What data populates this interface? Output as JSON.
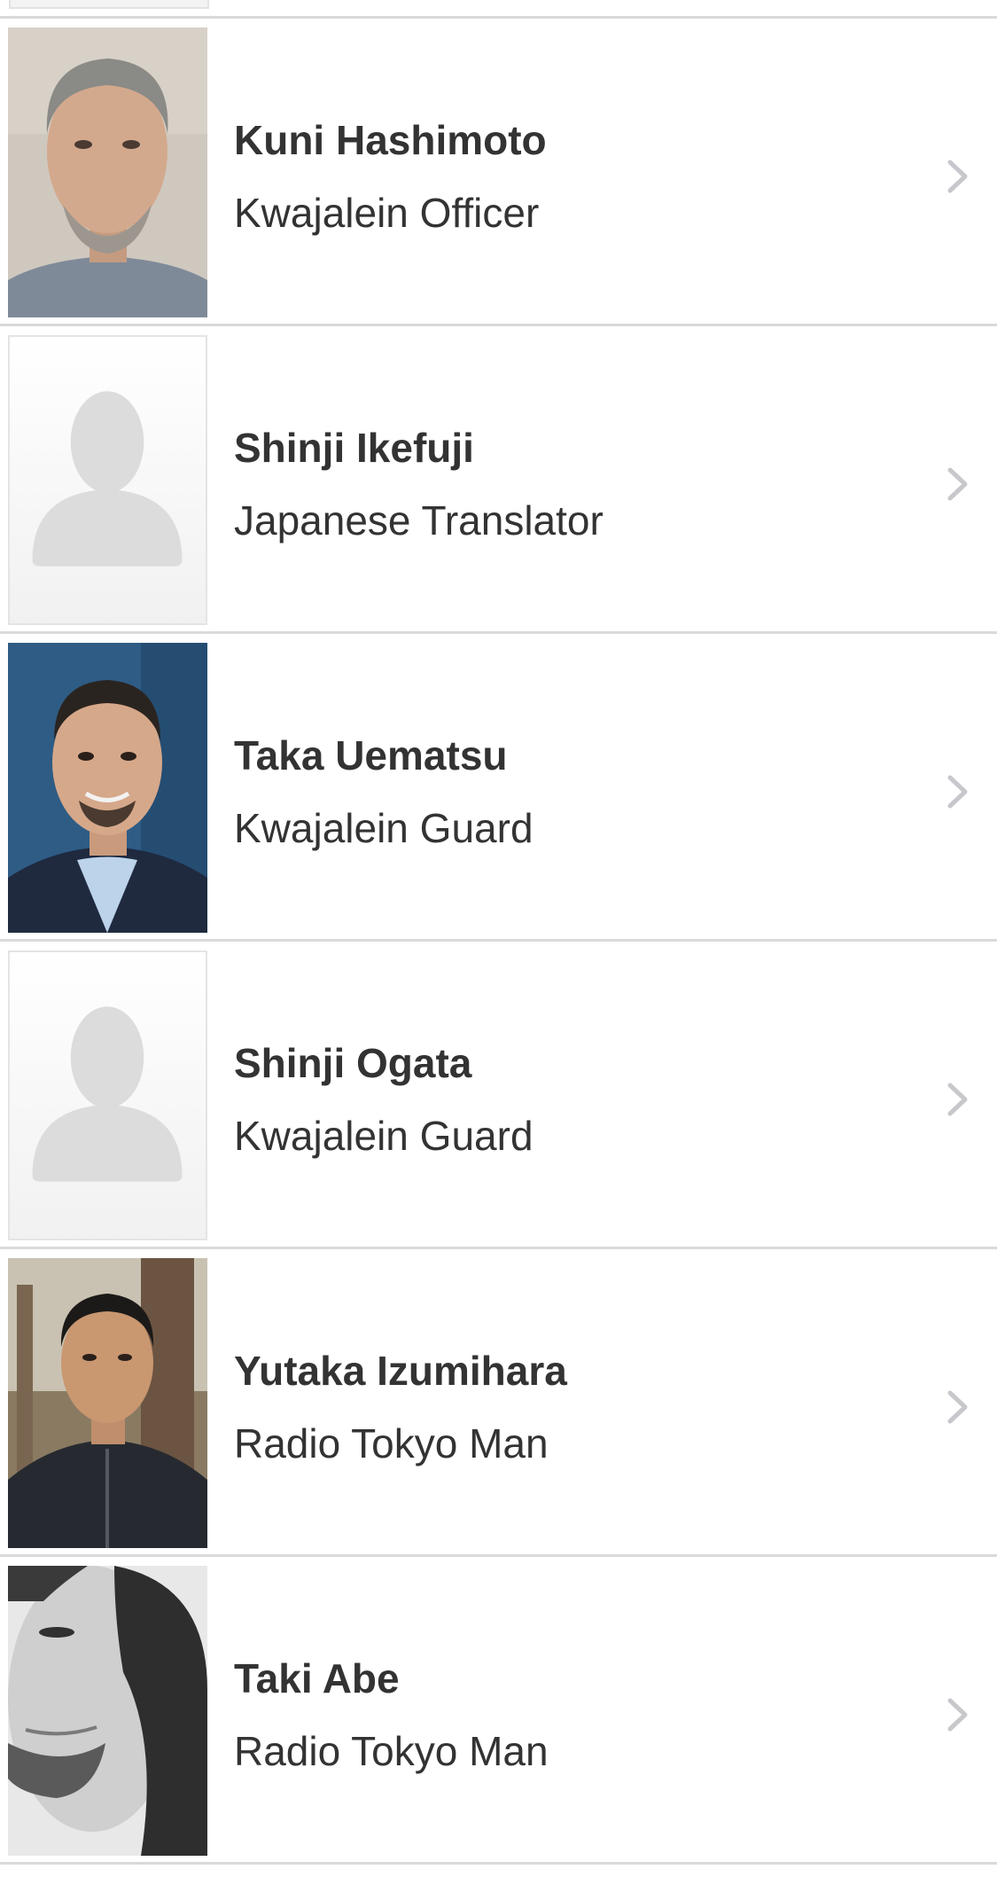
{
  "cast": [
    {
      "name": "Kuni Hashimoto",
      "role": "Kwajalein Officer",
      "photo": "photo",
      "chevron_icon": "chevron-right-icon"
    },
    {
      "name": "Shinji Ikefuji",
      "role": "Japanese Translator",
      "photo": "placeholder-avatar",
      "chevron_icon": "chevron-right-icon"
    },
    {
      "name": "Taka Uematsu",
      "role": "Kwajalein Guard",
      "photo": "photo",
      "chevron_icon": "chevron-right-icon"
    },
    {
      "name": "Shinji Ogata",
      "role": "Kwajalein Guard",
      "photo": "placeholder-avatar",
      "chevron_icon": "chevron-right-icon"
    },
    {
      "name": "Yutaka Izumihara",
      "role": "Radio Tokyo Man",
      "photo": "photo",
      "chevron_icon": "chevron-right-icon"
    },
    {
      "name": "Taki Abe",
      "role": "Radio Tokyo Man",
      "photo": "photo",
      "chevron_icon": "chevron-right-icon"
    }
  ],
  "colors": {
    "text": "#333333",
    "divider": "#d9d9d9",
    "chevron": "#c7c7cc",
    "placeholder_silhouette": "#dcdcdc"
  }
}
